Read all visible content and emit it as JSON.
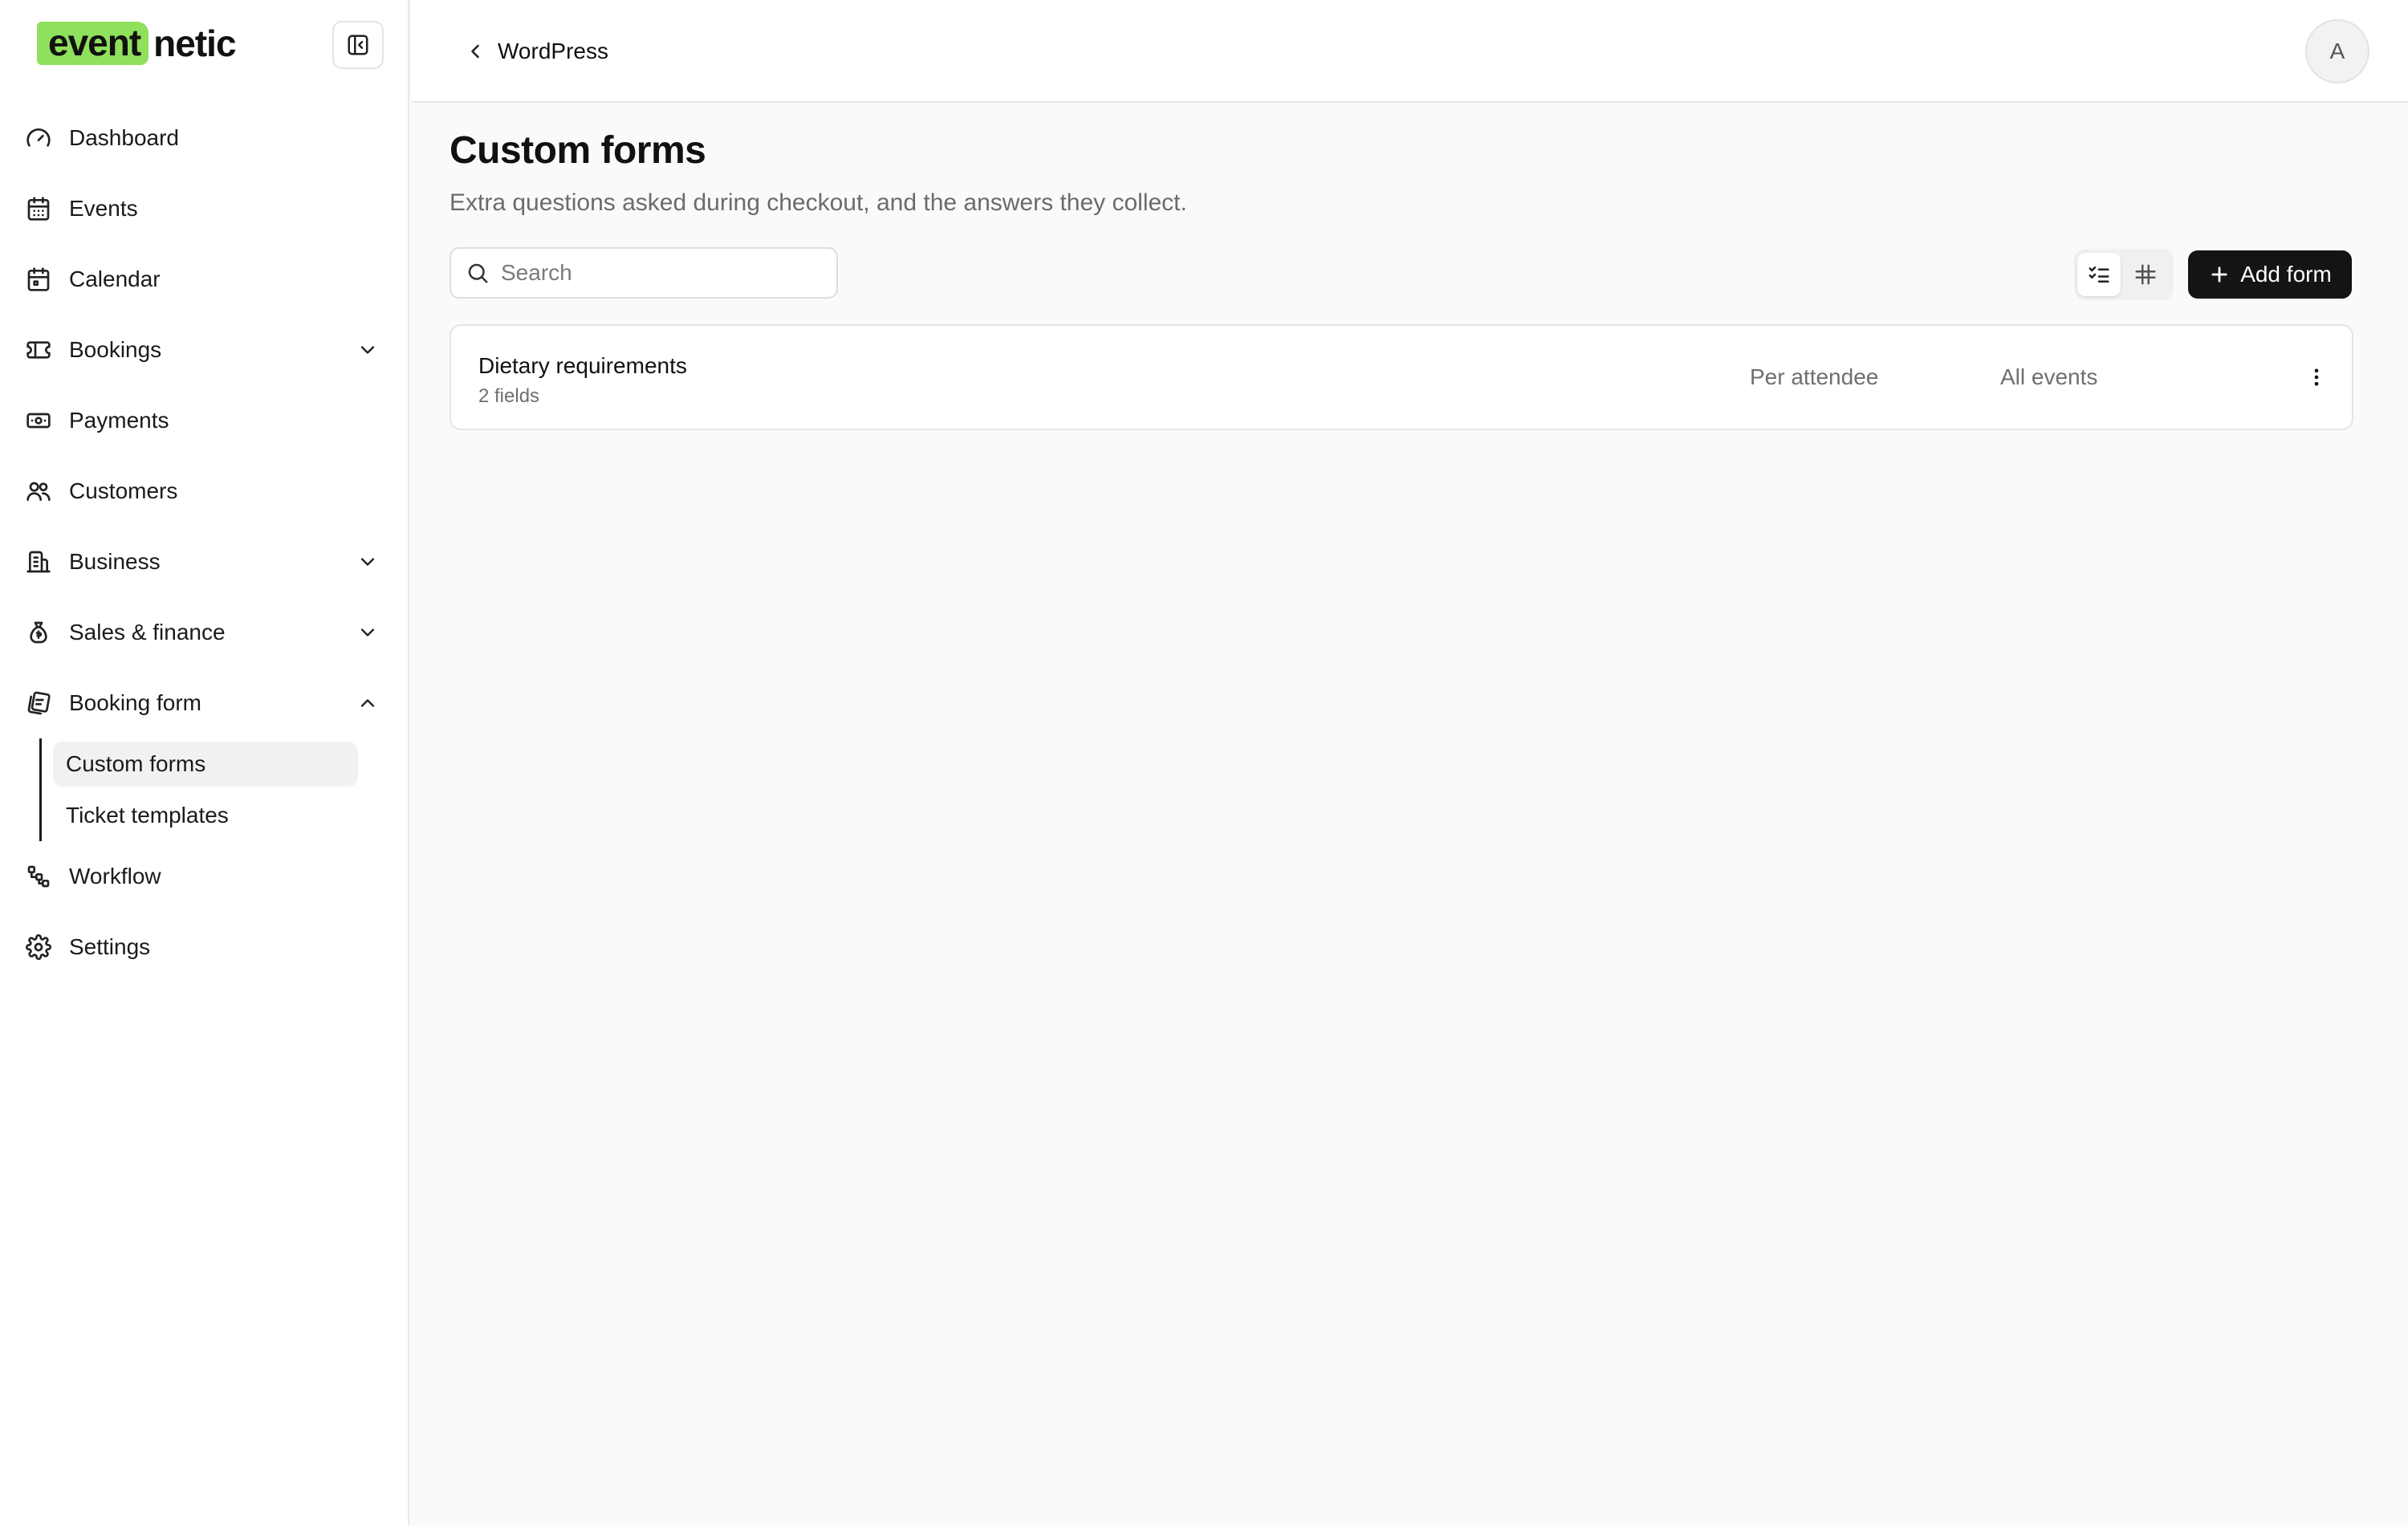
{
  "brand": {
    "logo_highlight": "event",
    "logo_rest": "netic",
    "accent_color": "#8fe05c"
  },
  "sidebar": {
    "items": [
      {
        "label": "Dashboard",
        "icon": "gauge-icon"
      },
      {
        "label": "Events",
        "icon": "calendar-days-icon"
      },
      {
        "label": "Calendar",
        "icon": "calendar-icon"
      },
      {
        "label": "Bookings",
        "icon": "ticket-icon",
        "expandable": true
      },
      {
        "label": "Payments",
        "icon": "banknote-icon"
      },
      {
        "label": "Customers",
        "icon": "users-icon"
      },
      {
        "label": "Business",
        "icon": "building-icon",
        "expandable": true
      },
      {
        "label": "Sales & finance",
        "icon": "money-bag-icon",
        "expandable": true
      },
      {
        "label": "Booking form",
        "icon": "form-cards-icon",
        "expandable": true,
        "expanded": true
      },
      {
        "label": "Workflow",
        "icon": "workflow-icon"
      },
      {
        "label": "Settings",
        "icon": "gear-icon"
      }
    ],
    "subitems": [
      {
        "label": "Custom forms",
        "active": true
      },
      {
        "label": "Ticket templates",
        "active": false
      }
    ]
  },
  "topbar": {
    "back_label": "WordPress",
    "avatar_initial": "A"
  },
  "main": {
    "title": "Custom forms",
    "subtitle": "Extra questions asked during checkout, and the answers they collect.",
    "search": {
      "placeholder": "Search",
      "value": ""
    },
    "view_toggle": {
      "active": "list"
    },
    "add_button_label": "Add form",
    "forms": [
      {
        "name": "Dietary requirements",
        "fields": "2 fields",
        "scope": "Per attendee",
        "events": "All events"
      }
    ]
  }
}
